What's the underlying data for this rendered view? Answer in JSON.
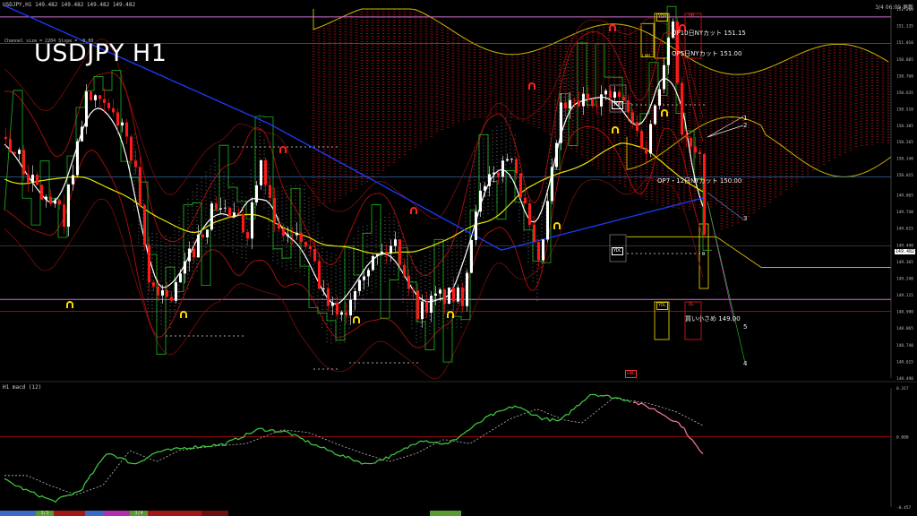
{
  "header": {
    "symbol_line": "USDJPY,H1  149.482 149.482 149.482 149.482",
    "channel_line": "Channel size = 2204  Slope = -0.00",
    "big_title": "USDJPY H1",
    "time_label": "3/4 06:09 更新",
    "macd_label": "H1 macd (12)"
  },
  "annotations": {
    "cut1": "OP10日NYカット 151.15",
    "cut2": "OP5日NYカット 151.00",
    "cut3": "OP7・12日NYカット 150.00",
    "buy": "買い小さめ 149.00",
    "ydh": "YDH",
    "ydo": "YDO",
    "ydc": "YDC",
    "ydl": "YDL",
    "lwh": "LWH",
    "lwl": "LWL",
    "dh": "DH",
    "dl": "DL",
    "o": "O",
    "n1": "1",
    "n2": "2",
    "n3": "3",
    "n4": "4",
    "n5": "5",
    "price_box": "149.482",
    "w": "W"
  },
  "taskbar": {
    "a": "3/3",
    "b": "3/4"
  },
  "colors": {
    "bull": "#ffffff",
    "bear": "#ff1a1a",
    "ma_white": "#ffffff",
    "ma_yellow": "#e6e600",
    "ma_blue": "#1a3cff",
    "ichimoku_span": "#c8b400",
    "cloud_red": "#8a1010",
    "macd_main": "#40d040",
    "macd_down": "#ff7a9a",
    "macd_signal": "#bbbbbb",
    "green_line": "#1db31d",
    "magenta_level": "#d070d0"
  },
  "chart_data": {
    "type": "candlestick",
    "symbol": "USDJPY",
    "timeframe": "H1",
    "ylim": [
      148.49,
      151.26
    ],
    "y_ticks": [
      151.26,
      151.135,
      151.01,
      150.885,
      150.76,
      150.635,
      150.51,
      150.385,
      150.265,
      150.14,
      150.015,
      149.865,
      149.74,
      149.615,
      149.49,
      149.365,
      149.24,
      149.115,
      148.99,
      148.865,
      148.74,
      148.615,
      148.49
    ],
    "macd_ylim": [
      -0.457,
      0.317
    ],
    "macd_ticks": [
      0.317,
      0.0,
      -0.457
    ],
    "levels": [
      {
        "name": "OP10日NYカット",
        "value": 151.15
      },
      {
        "name": "OP5日NYカット",
        "value": 151.0
      },
      {
        "name": "OP7・12日NYカット",
        "value": 150.0
      },
      {
        "name": "買い小さめ",
        "value": 149.0
      }
    ],
    "last_price": 149.482
  }
}
